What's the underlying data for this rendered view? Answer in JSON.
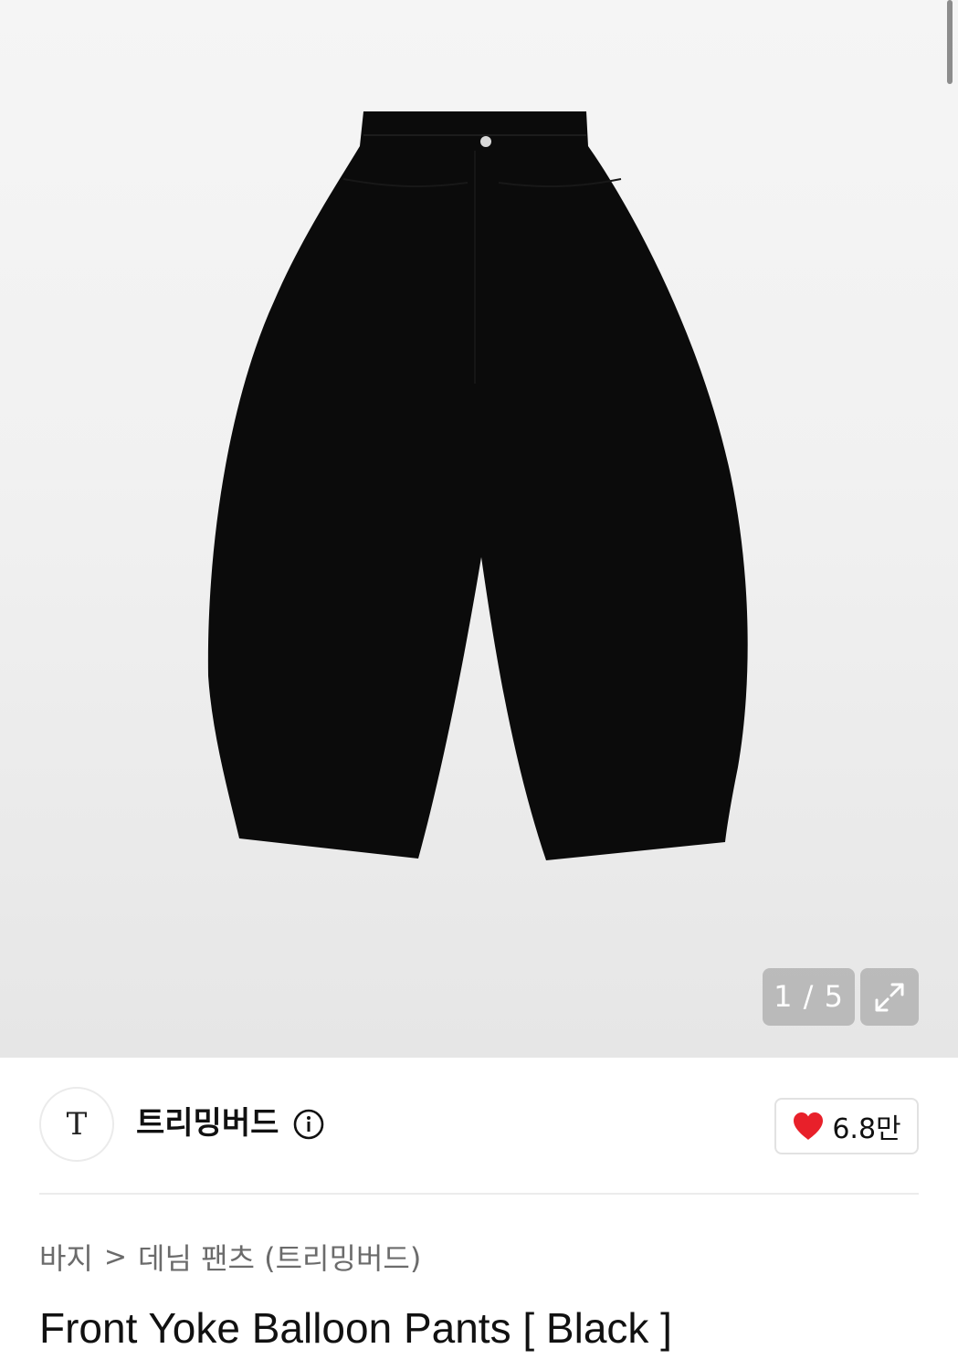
{
  "gallery": {
    "counter": "1 / 5",
    "image_alt": "Front Yoke Balloon Pants black product photo"
  },
  "brand": {
    "logo_text": "T",
    "name": "트리밍버드",
    "info_icon": "info-circle-icon"
  },
  "likes": {
    "icon": "heart-icon",
    "count": "6.8만",
    "heart_color": "#e8202a"
  },
  "breadcrumb": {
    "category": "바지",
    "separator": ">",
    "subcategory": "데님 팬츠 (트리밍버드)"
  },
  "product": {
    "title": "Front Yoke Balloon Pants [ Black ]"
  }
}
